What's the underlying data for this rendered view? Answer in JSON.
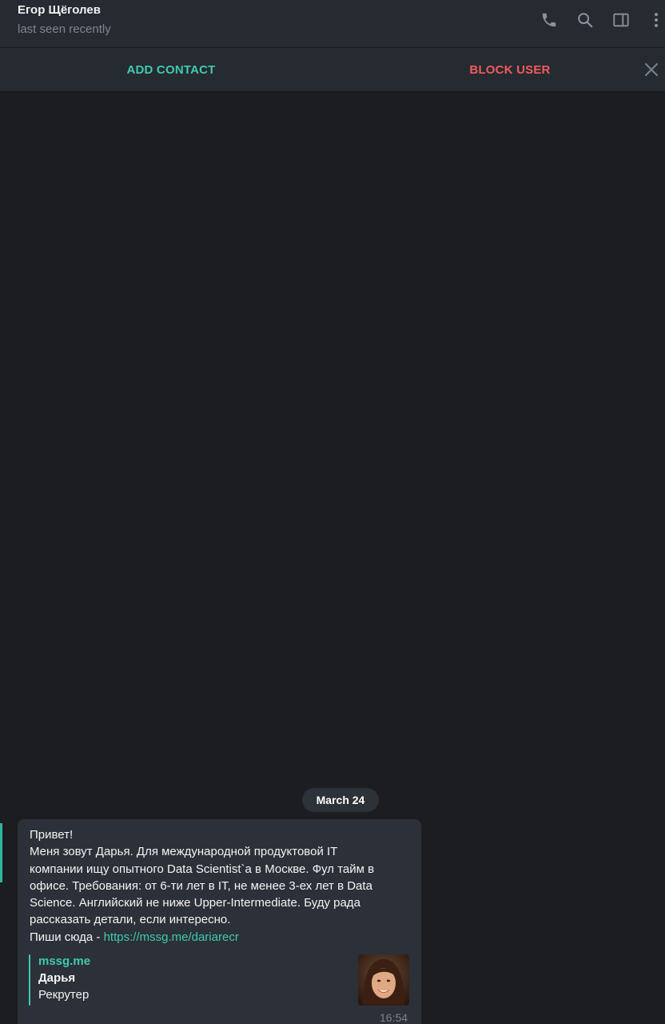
{
  "header": {
    "name": "Егор Щёголев",
    "status": "last seen recently",
    "icons": [
      "phone-icon",
      "search-icon",
      "sidebar-toggle-icon",
      "more-vertical-icon"
    ]
  },
  "actions": {
    "add_contact": "ADD CONTACT",
    "block_user": "BLOCK USER",
    "close_icon": "close-icon"
  },
  "colors": {
    "accent": "#3ecbb0",
    "danger": "#f15c5c",
    "background": "#1c1d21",
    "panel": "#262a31",
    "bubble": "#2c3038"
  },
  "chat": {
    "date_separator": "March 24",
    "message": {
      "line1": "Привет!",
      "body": "Меня зовут Дарья. Для международной продуктовой IT\nкомпании ищу опытного Data Scientist`а в Москве. Фул тайм в\nофисе. Требования: от 6-ти лет в IT, не менее 3-ех лет в Data\nScience. Английский не ниже Upper-Intermediate. Буду рада\nрассказать детали, если интересно.",
      "write_here": "Пиши сюда - ",
      "link": "https://mssg.me/dariarecr",
      "time": "16:54",
      "preview": {
        "site": "mssg.me",
        "title": "Дарья",
        "description": "Рекрутер"
      }
    }
  }
}
